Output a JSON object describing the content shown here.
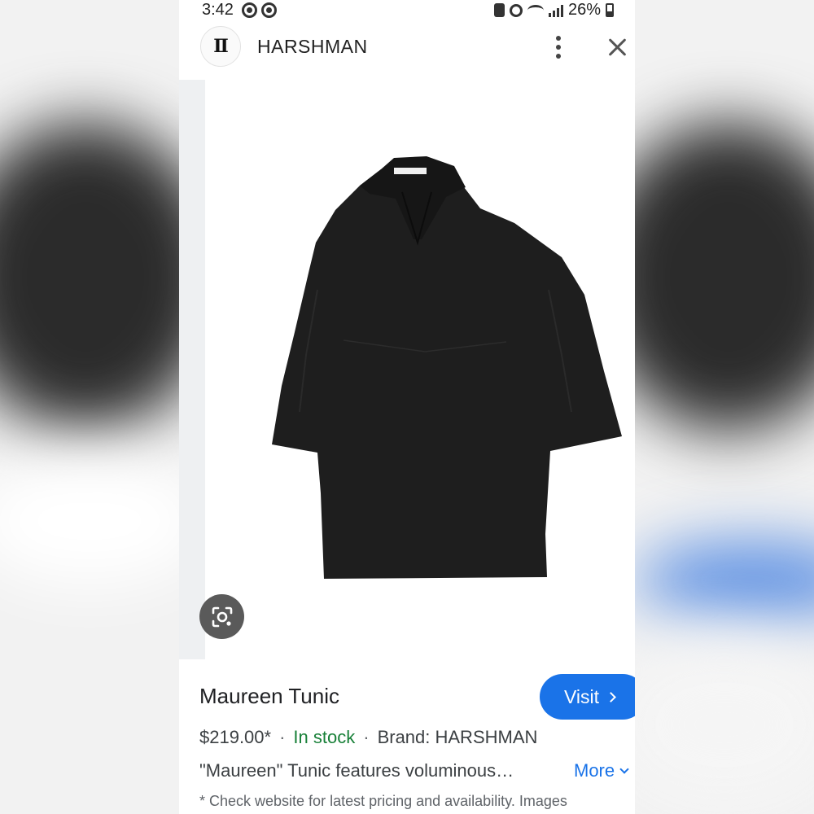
{
  "status_bar": {
    "time": "3:42",
    "battery": "26%",
    "icons": [
      "notification-icon",
      "notification-icon",
      "battery-saver-icon",
      "alarm-icon",
      "wifi-icon",
      "signal-icon",
      "battery-icon"
    ]
  },
  "header": {
    "logo_text": "H",
    "brand_name": "HARSHMAN",
    "more_icon": "more-vert-icon",
    "close_icon": "close-icon"
  },
  "image": {
    "product_description": "black tunic",
    "lens_icon": "google-lens-icon"
  },
  "product": {
    "title": "Maureen Tunic",
    "visit_label": "Visit",
    "price": "$219.00*",
    "separator": "·",
    "stock": "In stock",
    "brand": "Brand: HARSHMAN",
    "description": "\"Maureen\" Tunic features voluminous…",
    "more_label": "More",
    "disclaimer": "* Check website for latest pricing and availability. Images"
  },
  "colors": {
    "accent": "#1a73e8",
    "stock_green": "#188038",
    "text_primary": "#202124",
    "text_secondary": "#5f6368",
    "garment": "#1e1e1e"
  }
}
